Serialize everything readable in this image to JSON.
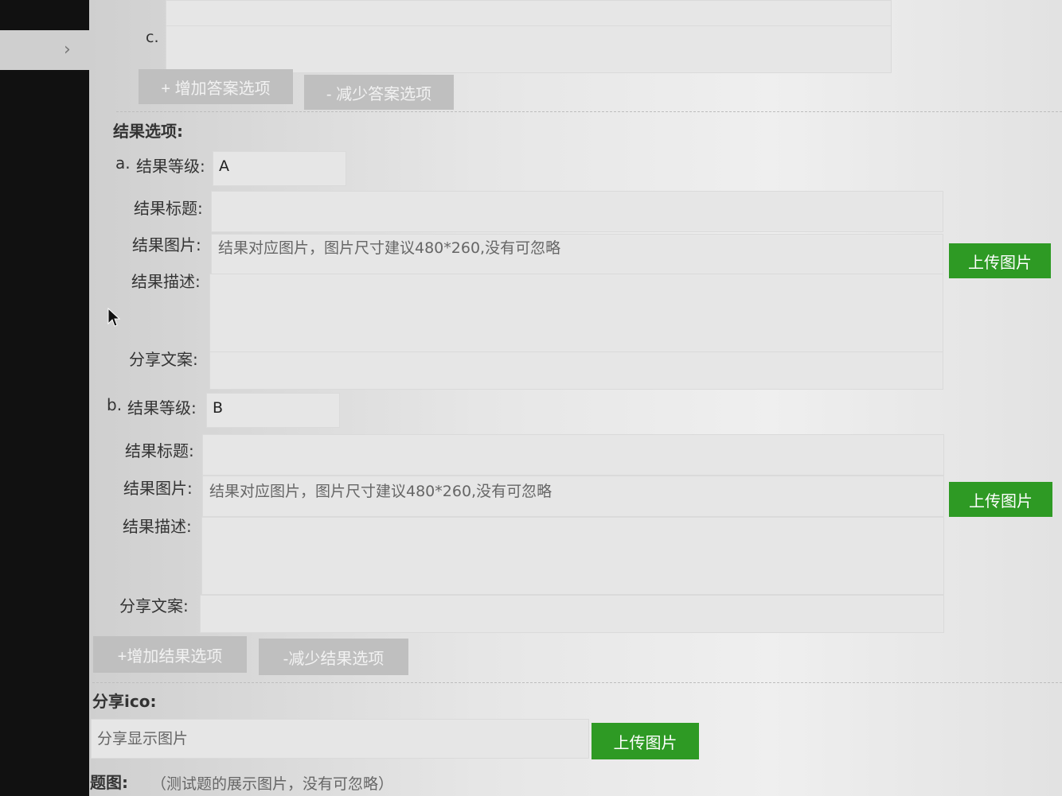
{
  "answer_section": {
    "option_c_label": "c.",
    "add_answer_btn": "+ 增加答案选项",
    "remove_answer_btn": "- 减少答案选项"
  },
  "result_section": {
    "title": "结果选项:",
    "items": [
      {
        "letter": "a.",
        "level_label": "结果等级:",
        "level_value": "A",
        "title_label": "结果标题:",
        "image_label": "结果图片:",
        "image_placeholder": "结果对应图片，图片尺寸建议480*260,没有可忽略",
        "upload_btn": "上传图片",
        "desc_label": "结果描述:",
        "share_label": "分享文案:"
      },
      {
        "letter": "b.",
        "level_label": "结果等级:",
        "level_value": "B",
        "title_label": "结果标题:",
        "image_label": "结果图片:",
        "image_placeholder": "结果对应图片，图片尺寸建议480*260,没有可忽略",
        "upload_btn": "上传图片",
        "desc_label": "结果描述:",
        "share_label": "分享文案:"
      }
    ],
    "add_result_btn": "+增加结果选项",
    "remove_result_btn": "-减少结果选项"
  },
  "share_ico": {
    "title": "分享ico:",
    "placeholder": "分享显示图片",
    "upload_btn": "上传图片"
  },
  "topic_image": {
    "label": "题图:",
    "hint": "（测试题的展示图片，没有可忽略）"
  }
}
